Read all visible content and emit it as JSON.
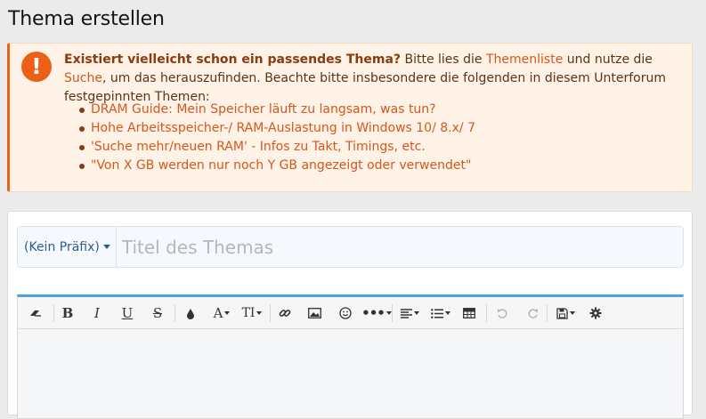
{
  "page": {
    "title": "Thema erstellen"
  },
  "notice": {
    "icon": "exclamation-circle-icon",
    "bold": "Existiert vielleicht schon ein passendes Thema?",
    "text_1": " Bitte lies die ",
    "link_threadlist": "Themenliste",
    "text_2": " und nutze die ",
    "link_search": "Suche",
    "text_3": ", um das herauszufinden. Beachte bitte insbesondere die folgenden in diesem Unterforum festgepinnten Themen:",
    "threads": [
      "DRAM Guide: Mein Speicher läuft zu langsam, was tun?",
      "Hohe Arbeitsspeicher-/ RAM-Auslastung in Windows 10/ 8.x/ 7",
      "'Suche mehr/neuen RAM' - Infos zu Takt, Timings, etc.",
      "\"Von X GB werden nur noch Y GB angezeigt oder verwendet\""
    ]
  },
  "form": {
    "prefix_label": "(Kein Präfix)",
    "title_placeholder": "Titel des Themas"
  },
  "toolbar": {
    "buttons": [
      "eraser-icon",
      "bold-icon",
      "italic-icon",
      "underline-icon",
      "strikethrough-icon",
      "text-color-icon",
      "font-family-icon",
      "font-size-icon",
      "link-icon",
      "image-icon",
      "smiley-icon",
      "more-icon",
      "align-icon",
      "list-icon",
      "table-icon",
      "undo-icon",
      "redo-icon",
      "save-draft-icon",
      "settings-icon"
    ]
  },
  "colors": {
    "accent": "#ec5f17",
    "link": "#d8561b",
    "editor_border": "#4da3e0"
  }
}
